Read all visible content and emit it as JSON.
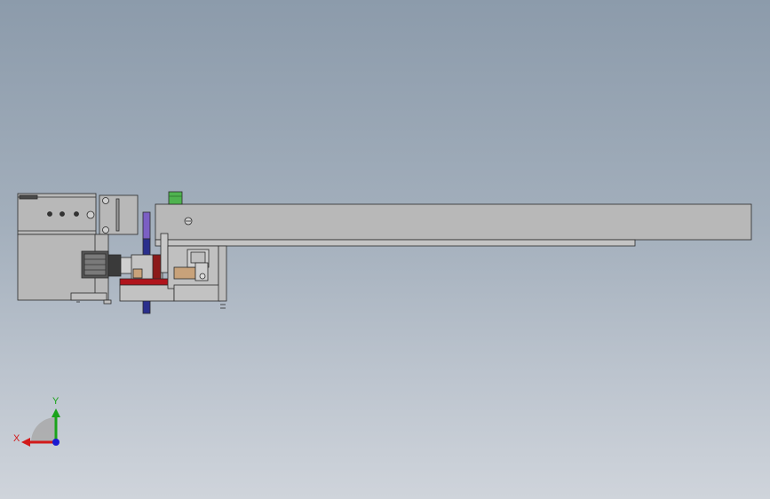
{
  "viewport": {
    "background_top": "#8c9bab",
    "background_bottom": "#cfd4db"
  },
  "triad": {
    "x_label": "X",
    "y_label": "Y",
    "x_color": "#d21a1a",
    "y_color": "#1aa31a",
    "z_color": "#1a1ad2"
  },
  "model": {
    "body_color": "#b8b8b8",
    "edge_color": "#2a2a2a",
    "accent_red": "#b0141c",
    "accent_blue": "#2a2f8c",
    "accent_purple": "#7b5fc4",
    "accent_green": "#4fb34f",
    "accent_tan": "#c8a27a"
  }
}
